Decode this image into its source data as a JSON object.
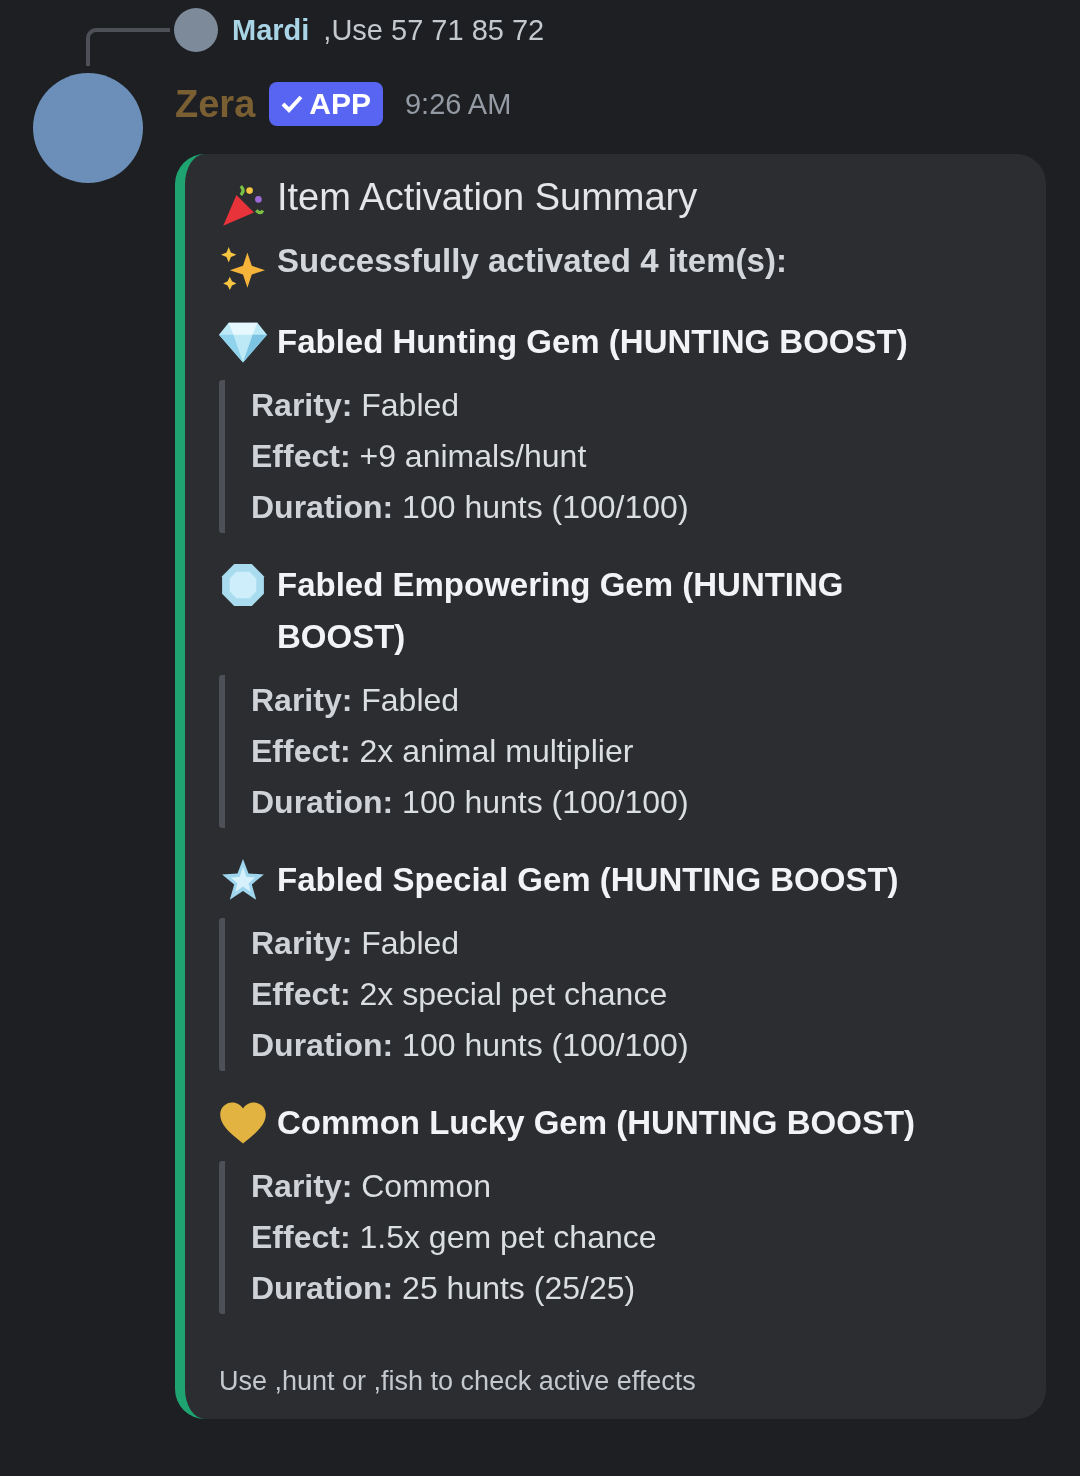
{
  "reply": {
    "author": "Mardi",
    "text": ",Use 57 71 85 72"
  },
  "message": {
    "author": "Zera",
    "badge": "APP",
    "time": "9:26 AM"
  },
  "embed": {
    "title": "Item Activation Summary",
    "subtitle": "Successfully activated 4 item(s):",
    "items": [
      {
        "title": "Fabled Hunting Gem (HUNTING BOOST)",
        "details": [
          "**Rarity:** Fabled",
          "**Effect:** +9 animals/hunt",
          "**Duration:** 100 hunts (100/100)"
        ]
      },
      {
        "title": "Fabled Empowering Gem (HUNTING BOOST)",
        "details": [
          "**Rarity:** Fabled",
          "**Effect:** 2x animal multiplier",
          "**Duration:** 100 hunts (100/100)"
        ]
      },
      {
        "title": "Fabled Special Gem (HUNTING BOOST)",
        "details": [
          "**Rarity:** Fabled",
          "**Effect:** 2x special pet chance",
          "**Duration:** 100 hunts (100/100)"
        ]
      },
      {
        "title": "Common Lucky Gem (HUNTING BOOST)",
        "details": [
          "**Rarity:** Common",
          "**Effect:** 1.5x gem pet chance",
          "**Duration:** 25 hunts (25/25)"
        ]
      }
    ],
    "footer": "Use ,hunt or ,fish to check active effects"
  }
}
